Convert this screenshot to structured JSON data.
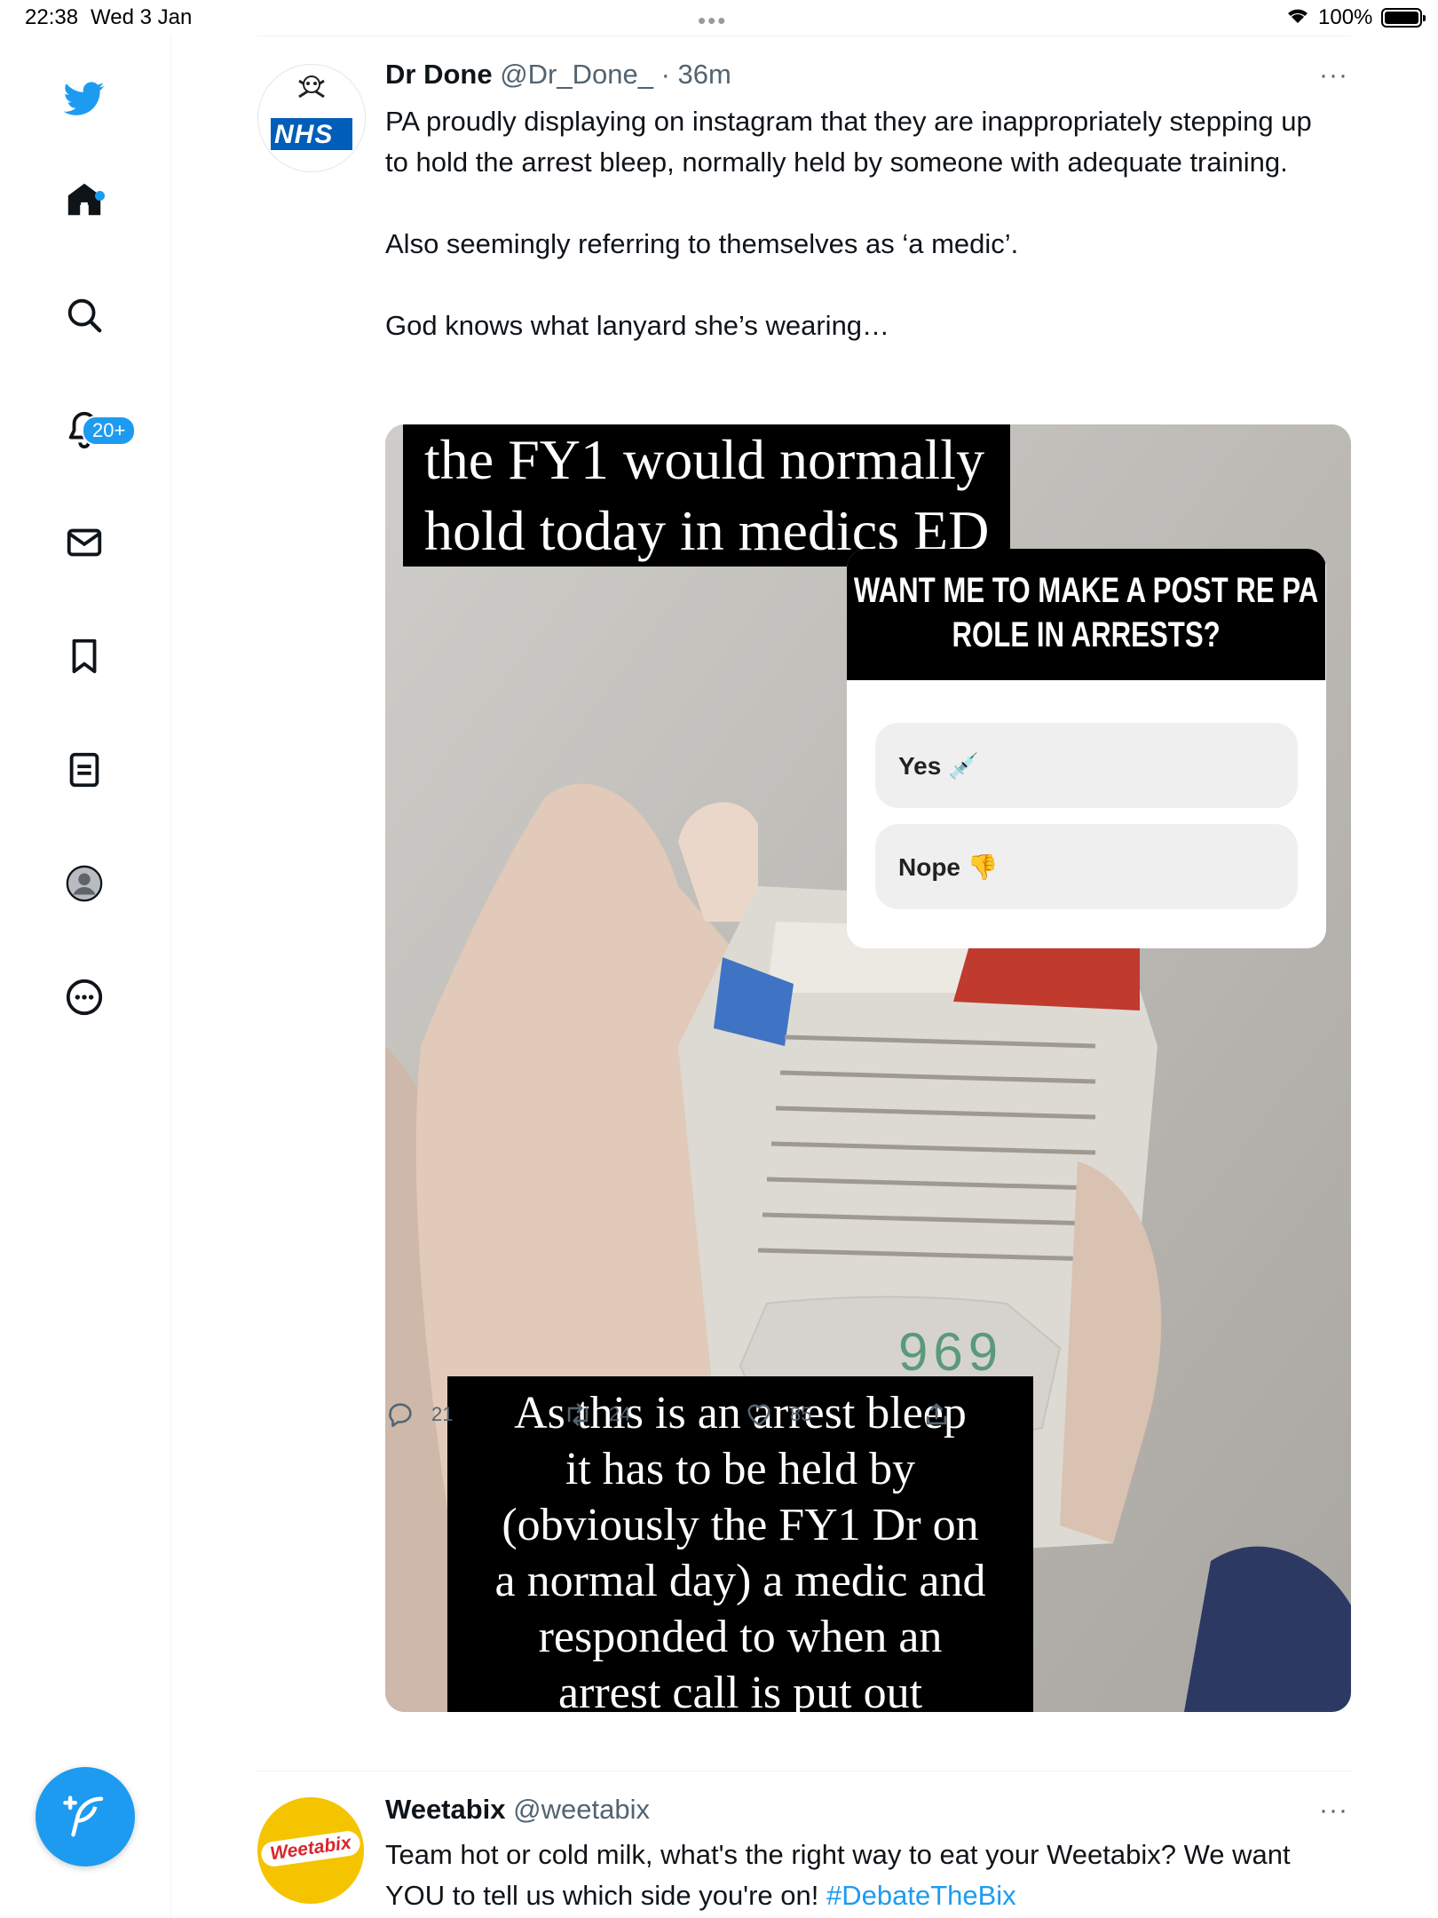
{
  "status_bar": {
    "time": "22:38",
    "date": "Wed 3 Jan",
    "battery": "100%"
  },
  "sidebar": {
    "notification_badge": "20+"
  },
  "tweets": [
    {
      "author_name": "Dr Done",
      "handle": "@Dr_Done_",
      "time": "· 36m",
      "avatar_label": "NHS",
      "text": "PA proudly displaying on instagram that they are inappropriately stepping up to hold the arrest bleep, normally held by someone with adequate training.\n\nAlso seemingly referring to themselves as ‘a medic’.\n\nGod knows what lanyard she’s wearing…",
      "media": {
        "caption_top": "the FY1 would normally\nhold today in medics ED",
        "poll_question": "WANT ME TO MAKE A POST RE PA ROLE IN ARRESTS?",
        "poll_options": [
          "Yes 💉",
          "Nope 👎"
        ],
        "caption_bottom": "As this is an arrest bleep\nit has to be held by\n(obviously the FY1 Dr on\na normal day) a medic and\nresponded to when an\narrest call is put out",
        "bleep_number": "969"
      },
      "actions": {
        "replies": "21",
        "retweets": "24",
        "likes": "85"
      }
    },
    {
      "author_name": "Weetabix",
      "handle": "@weetabix",
      "avatar_label": "Weetabix",
      "text": "Team hot or cold milk, what's the right way to eat your Weetabix? We want YOU to tell us which side you're on! ",
      "hashtag": "#DebateTheBix"
    }
  ]
}
